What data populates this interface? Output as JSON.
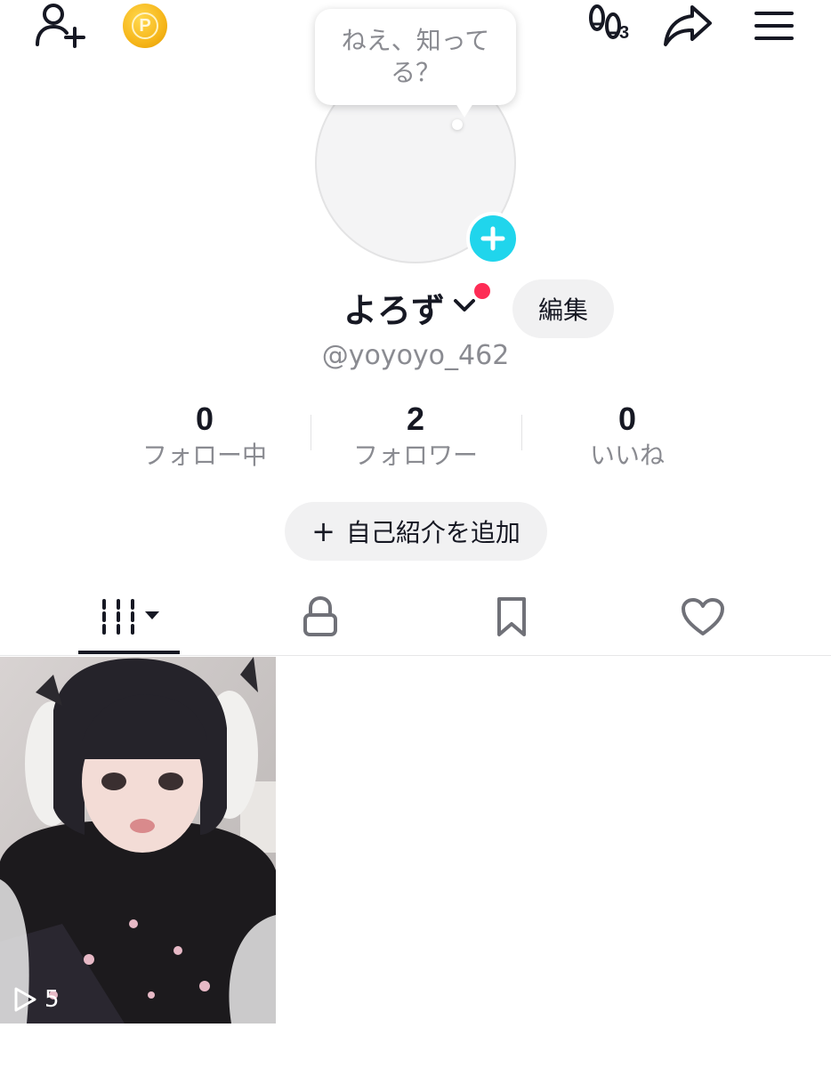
{
  "header": {
    "add_friend_icon": "person-plus-icon",
    "coin_icon": "coin-icon",
    "coin_letter": "P",
    "footprint_icon": "footprints-icon",
    "footprint_count": "3",
    "share_icon": "share-arrow-icon",
    "menu_icon": "hamburger-menu-icon"
  },
  "bubble": {
    "text": "ねえ、知ってる？"
  },
  "profile": {
    "name": "よろず",
    "handle": "@yoyoyo_462",
    "edit_label": "編集",
    "accent_color": "#20d5ec",
    "notice_color": "#fe2c55"
  },
  "stats": [
    {
      "value": "0",
      "label": "フォロー中"
    },
    {
      "value": "2",
      "label": "フォロワー"
    },
    {
      "value": "0",
      "label": "いいね"
    }
  ],
  "bio_button": {
    "icon": "+",
    "label": "自己紹介を追加"
  },
  "tabs": [
    {
      "name": "videos",
      "icon": "grid-bars-icon",
      "active": true
    },
    {
      "name": "private",
      "icon": "lock-icon"
    },
    {
      "name": "favorites",
      "icon": "bookmark-icon"
    },
    {
      "name": "liked",
      "icon": "heart-icon"
    }
  ],
  "videos": [
    {
      "views": "5",
      "play_icon": "play-outline-icon"
    }
  ]
}
